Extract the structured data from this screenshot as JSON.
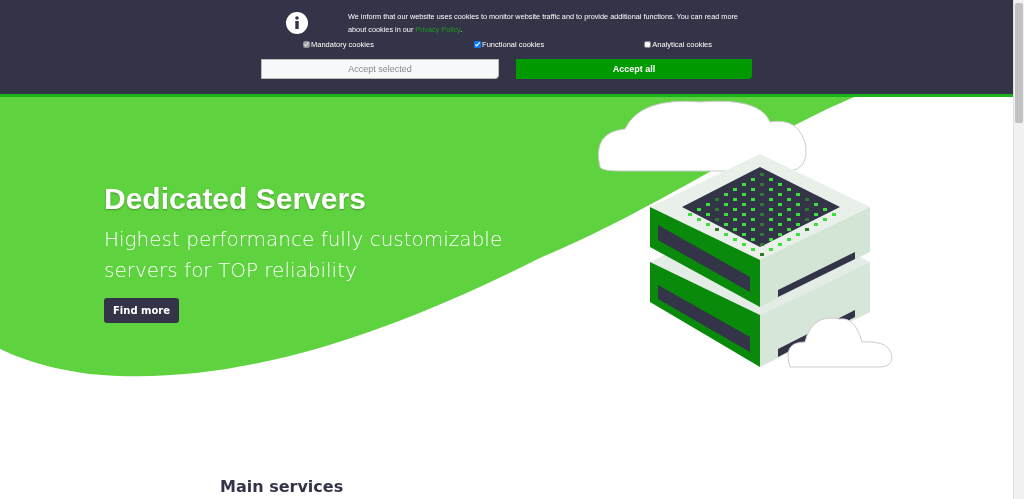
{
  "cookie_banner": {
    "message": "We inform that our website uses cookies to monitor website traffic and to provide additional functions. You can read more about cookies in our ",
    "link": "Privacy Policy",
    "message_end": ".",
    "options": [
      {
        "label": "Mandatory cookies",
        "checked": true,
        "disabled": true
      },
      {
        "label": "Functional cookies",
        "checked": true,
        "disabled": false
      },
      {
        "label": "Analytical cookies",
        "checked": false,
        "disabled": false
      }
    ],
    "buttons": [
      {
        "label": "Accept selected",
        "kind": "secondary"
      },
      {
        "label": "Accept all",
        "kind": "primary"
      }
    ]
  },
  "hero": {
    "title": "Dedicated Servers",
    "subtitle": "Highest performance fully customizable servers for TOP reliability",
    "button": "Find more"
  },
  "section": {
    "title": "Main services"
  }
}
